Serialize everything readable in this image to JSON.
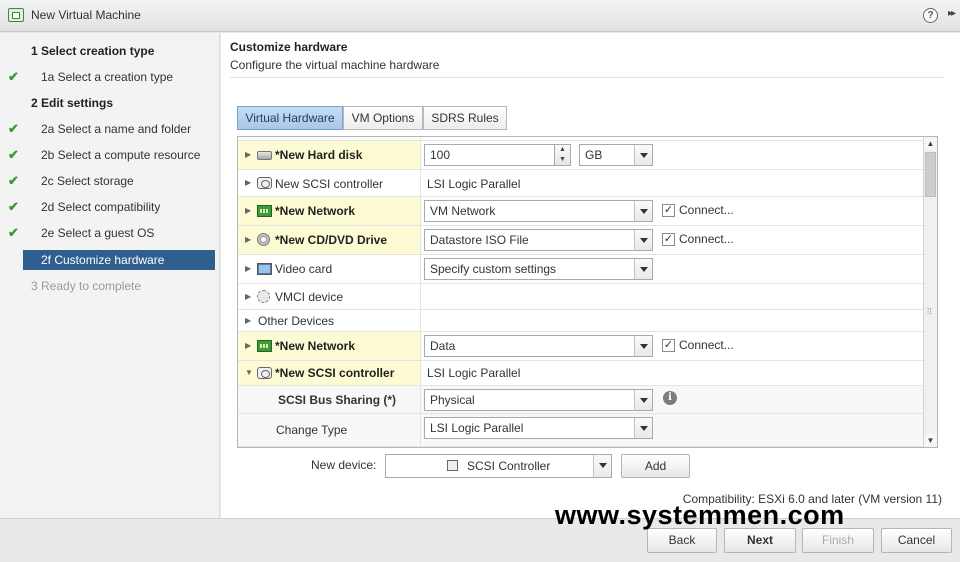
{
  "window": {
    "title": "New Virtual Machine",
    "help": "?",
    "expand": "▸▸"
  },
  "sidebar": {
    "steps": [
      {
        "label": "1  Select creation type"
      },
      {
        "label": "1a  Select a creation type"
      },
      {
        "label": "2  Edit settings"
      },
      {
        "label": "2a  Select a name and folder"
      },
      {
        "label": "2b  Select a compute resource"
      },
      {
        "label": "2c  Select storage"
      },
      {
        "label": "2d  Select compatibility"
      },
      {
        "label": "2e  Select a guest OS"
      },
      {
        "label": "2f  Customize hardware"
      },
      {
        "label": "3  Ready to complete"
      }
    ]
  },
  "main": {
    "title": "Customize hardware",
    "subtitle": "Configure the virtual machine hardware",
    "tabs": [
      "Virtual Hardware",
      "VM Options",
      "SDRS Rules"
    ]
  },
  "hardware": {
    "hard_disk": {
      "label": "*New Hard disk",
      "size": "100",
      "unit": "GB"
    },
    "scsi_controller": {
      "label": "New SCSI controller",
      "value": "LSI Logic Parallel"
    },
    "network1": {
      "label": "*New Network",
      "value": "VM Network",
      "connect": "Connect..."
    },
    "cd_drive": {
      "label": "*New CD/DVD Drive",
      "value": "Datastore ISO File",
      "connect": "Connect..."
    },
    "video_card": {
      "label": "Video card",
      "value": "Specify custom settings"
    },
    "vmci": {
      "label": "VMCI device"
    },
    "other": {
      "label": "Other Devices"
    },
    "network2": {
      "label": "*New Network",
      "value": "Data",
      "connect": "Connect..."
    },
    "scsi_new": {
      "label": "*New SCSI controller",
      "value": "LSI Logic Parallel"
    },
    "bus_sharing": {
      "label": "SCSI Bus Sharing (*)",
      "value": "Physical"
    },
    "change_type": {
      "label": "Change Type",
      "value": "LSI Logic Parallel"
    }
  },
  "new_device": {
    "label": "New device:",
    "value": "SCSI Controller",
    "add": "Add"
  },
  "compatibility": "Compatibility: ESXi 6.0 and later (VM version 11)",
  "footer": {
    "back": "Back",
    "next": "Next",
    "finish": "Finish",
    "cancel": "Cancel"
  },
  "watermark": "www.systemmen.com",
  "colors": {
    "active_step": "#2f5e8f",
    "check": "#3b9b33",
    "highlight_row": "#fdfbd3",
    "active_tab": "#a9c7ea"
  }
}
